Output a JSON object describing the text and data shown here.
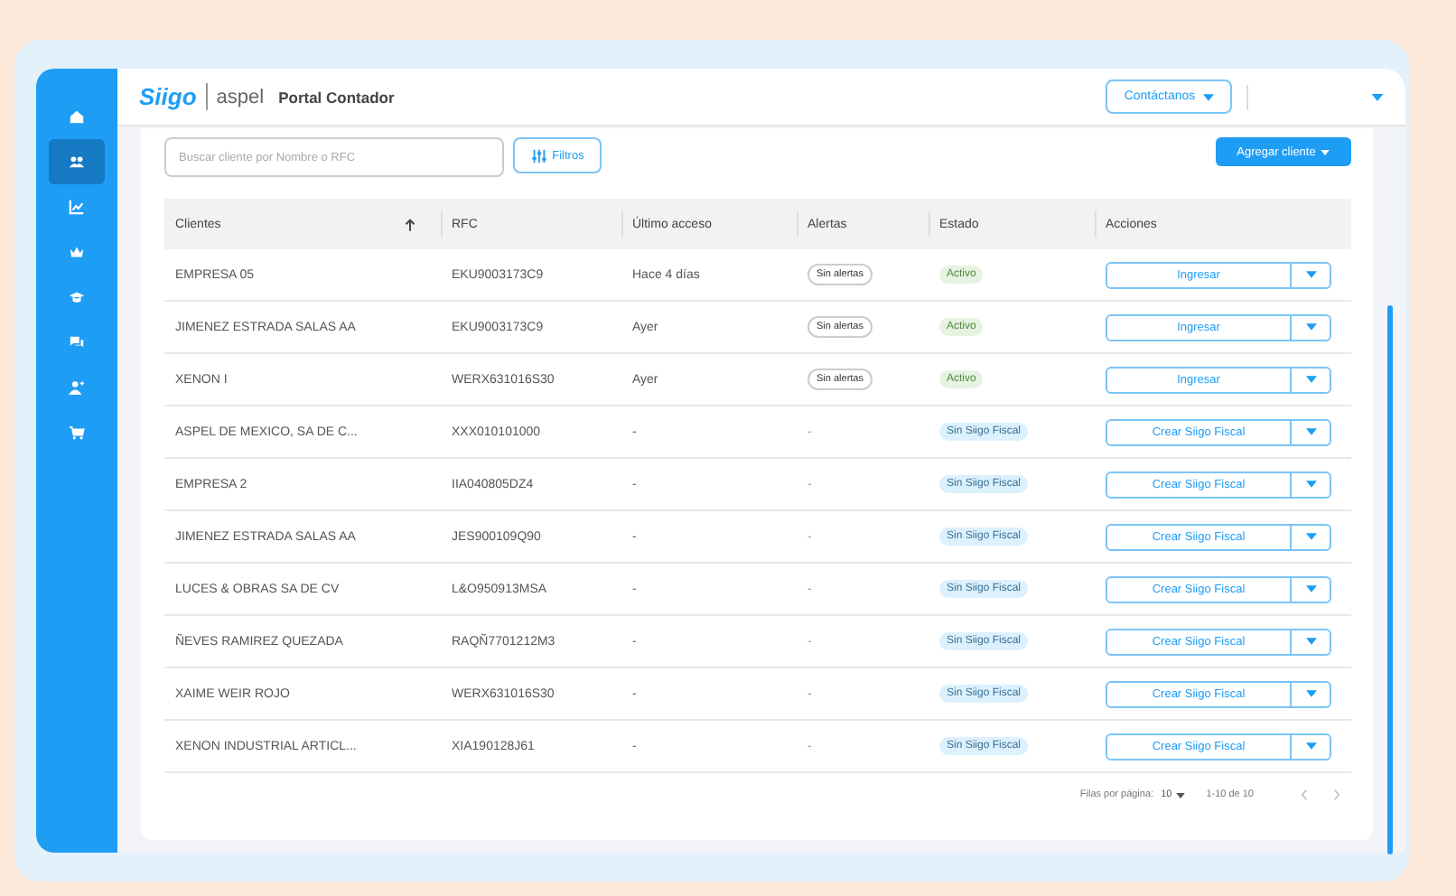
{
  "header": {
    "logo_primary": "Siigo",
    "logo_secondary": "aspel",
    "title": "Portal Contador",
    "contact_button": "Contáctanos"
  },
  "sidebar": {
    "items": [
      {
        "selected": false
      },
      {
        "selected": true
      },
      {
        "selected": false
      },
      {
        "selected": false
      },
      {
        "selected": false
      },
      {
        "selected": false
      },
      {
        "selected": false
      },
      {
        "selected": false
      }
    ]
  },
  "toolbar": {
    "search": {
      "placeholder": "Buscar cliente por Nombre o RFC"
    },
    "filter_button": "Filtros",
    "add_button": "Agregar cliente"
  },
  "table": {
    "columns": [
      "Clientes",
      "RFC",
      "Último acceso",
      "Alertas",
      "Estado",
      "Acciones"
    ],
    "rows": [
      {
        "client": "EMPRESA 05",
        "rfc": "EKU9003173C9",
        "last_access": "Hace 4 días",
        "alert": {
          "text": "Sin alertas",
          "kind": "badge"
        },
        "status": {
          "text": "Activo",
          "kind": "active"
        },
        "action": "Ingresar"
      },
      {
        "client": "JIMENEZ ESTRADA SALAS AA",
        "rfc": "EKU9003173C9",
        "last_access": "Ayer",
        "alert": {
          "text": "Sin alertas",
          "kind": "badge"
        },
        "status": {
          "text": "Activo",
          "kind": "active"
        },
        "action": "Ingresar"
      },
      {
        "client": "XENON I",
        "rfc": "WERX631016S30",
        "last_access": "Ayer",
        "alert": {
          "text": "Sin alertas",
          "kind": "badge"
        },
        "status": {
          "text": "Activo",
          "kind": "active"
        },
        "action": "Ingresar"
      },
      {
        "client": "ASPEL DE MEXICO, SA DE C...",
        "rfc": "XXX010101000",
        "last_access": "-",
        "alert": {
          "text": "-",
          "kind": "plain"
        },
        "status": {
          "text": "Sin Siigo Fiscal",
          "kind": "none"
        },
        "action": "Crear Siigo Fiscal"
      },
      {
        "client": "EMPRESA 2",
        "rfc": "IIA040805DZ4",
        "last_access": "-",
        "alert": {
          "text": "-",
          "kind": "plain"
        },
        "status": {
          "text": "Sin Siigo Fiscal",
          "kind": "none"
        },
        "action": "Crear Siigo Fiscal"
      },
      {
        "client": "JIMENEZ ESTRADA SALAS AA",
        "rfc": "JES900109Q90",
        "last_access": "-",
        "alert": {
          "text": "-",
          "kind": "plain"
        },
        "status": {
          "text": "Sin Siigo Fiscal",
          "kind": "none"
        },
        "action": "Crear Siigo Fiscal"
      },
      {
        "client": "LUCES & OBRAS SA DE CV",
        "rfc": "L&O950913MSA",
        "last_access": "-",
        "alert": {
          "text": "-",
          "kind": "plain"
        },
        "status": {
          "text": "Sin Siigo Fiscal",
          "kind": "none"
        },
        "action": "Crear Siigo Fiscal"
      },
      {
        "client": "ÑEVES RAMIREZ QUEZADA",
        "rfc": "RAQÑ7701212M3",
        "last_access": "-",
        "alert": {
          "text": "-",
          "kind": "plain"
        },
        "status": {
          "text": "Sin Siigo Fiscal",
          "kind": "none"
        },
        "action": "Crear Siigo Fiscal"
      },
      {
        "client": "XAIME WEIR ROJO",
        "rfc": "WERX631016S30",
        "last_access": "-",
        "alert": {
          "text": "-",
          "kind": "plain"
        },
        "status": {
          "text": "Sin Siigo Fiscal",
          "kind": "none"
        },
        "action": "Crear Siigo Fiscal"
      },
      {
        "client": "XENON INDUSTRIAL ARTICL...",
        "rfc": "XIA190128J61",
        "last_access": "-",
        "alert": {
          "text": "-",
          "kind": "plain"
        },
        "status": {
          "text": "Sin Siigo Fiscal",
          "kind": "none"
        },
        "action": "Crear Siigo Fiscal"
      }
    ]
  },
  "pagination": {
    "rows_label": "Filas por página:",
    "rows_value": "10",
    "range": "1-10 de 10"
  }
}
